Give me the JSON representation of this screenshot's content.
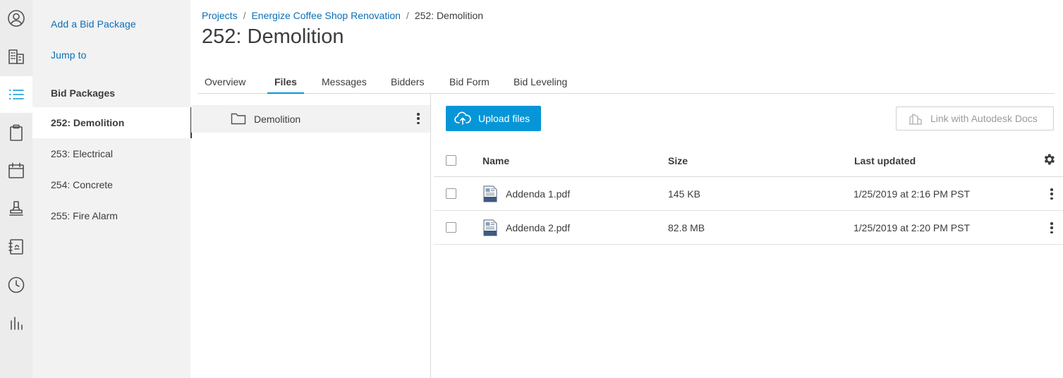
{
  "rail": {
    "items": [
      {
        "icon": "user-circle-icon"
      },
      {
        "icon": "building-icon"
      },
      {
        "icon": "list-icon"
      },
      {
        "icon": "clipboard-icon"
      },
      {
        "icon": "calendar-icon"
      },
      {
        "icon": "stamp-icon"
      },
      {
        "icon": "notebook-icon"
      },
      {
        "icon": "clock-icon"
      },
      {
        "icon": "bar-chart-icon"
      }
    ],
    "active_index": 2
  },
  "sidebar": {
    "add_link": "Add a Bid Package",
    "jump_link": "Jump to",
    "heading": "Bid Packages",
    "items": [
      {
        "label": "252: Demolition"
      },
      {
        "label": "253: Electrical"
      },
      {
        "label": "254: Concrete"
      },
      {
        "label": "255: Fire Alarm"
      }
    ],
    "active_index": 0
  },
  "breadcrumb": {
    "projects": "Projects",
    "project": "Energize Coffee Shop Renovation",
    "current": "252: Demolition",
    "separator": "/"
  },
  "page_title": "252: Demolition",
  "tabs": [
    {
      "label": "Overview"
    },
    {
      "label": "Files"
    },
    {
      "label": "Messages"
    },
    {
      "label": "Bidders"
    },
    {
      "label": "Bid Form"
    },
    {
      "label": "Bid Leveling"
    }
  ],
  "active_tab": "Files",
  "folders": [
    {
      "name": "Demolition"
    }
  ],
  "toolbar": {
    "upload_label": "Upload files",
    "link_label": "Link with Autodesk Docs"
  },
  "table": {
    "columns": {
      "name": "Name",
      "size": "Size",
      "updated": "Last updated"
    },
    "rows": [
      {
        "name": "Addenda 1.pdf",
        "size": "145 KB",
        "updated": "1/25/2019 at 2:16 PM PST"
      },
      {
        "name": "Addenda 2.pdf",
        "size": "82.8 MB",
        "updated": "1/25/2019 at 2:20 PM PST"
      }
    ]
  },
  "colors": {
    "accent": "#0696d7",
    "link": "#0a6fb5",
    "rail_bg": "#ececec",
    "sidebar_bg": "#f2f2f2"
  }
}
